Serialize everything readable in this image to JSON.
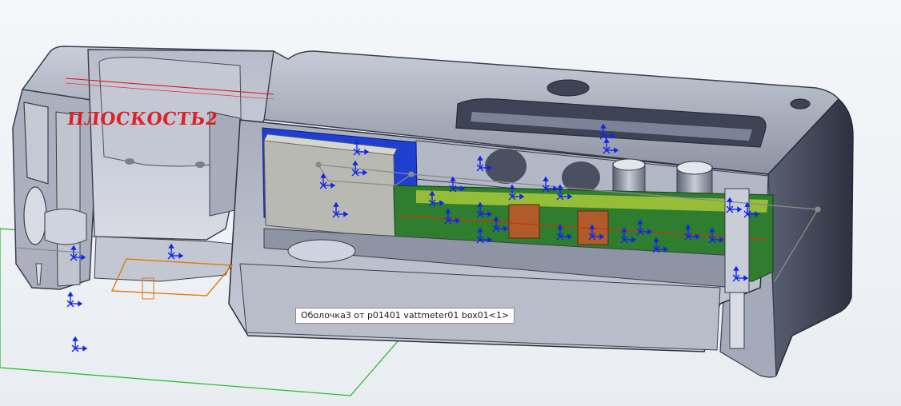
{
  "viewport": {
    "plane_label": "ПЛОСКОСТЬ2",
    "tooltip": "Оболочка3 от p01401 vattmeter01 box01<1>"
  },
  "colors": {
    "background": "#f1f3f6",
    "body_shell": "#a3a9b8",
    "body_dark": "#3b4152",
    "pcb": "#2f7d2f",
    "connector_blue": "#1e3fd0",
    "sketch_plane": "#22bb22",
    "sketch_orange": "#e07a10",
    "plane_red": "#e0151a",
    "dimension_arrows": "#1227e6"
  },
  "icons": [
    "triad-arrow-icon"
  ]
}
